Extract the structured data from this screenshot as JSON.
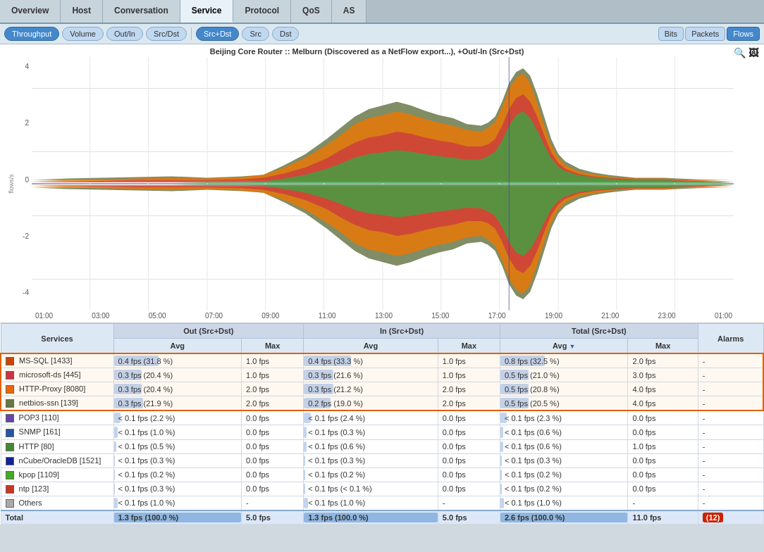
{
  "topNav": {
    "tabs": [
      {
        "label": "Overview",
        "active": false
      },
      {
        "label": "Host",
        "active": false
      },
      {
        "label": "Conversation",
        "active": false
      },
      {
        "label": "Service",
        "active": true
      },
      {
        "label": "Protocol",
        "active": false
      },
      {
        "label": "QoS",
        "active": false
      },
      {
        "label": "AS",
        "active": false
      }
    ]
  },
  "subNav": {
    "leftButtons": [
      {
        "label": "Throughput",
        "active": true
      },
      {
        "label": "Volume",
        "active": false
      },
      {
        "label": "Out/In",
        "active": false
      },
      {
        "label": "Src/Dst",
        "active": false
      },
      {
        "label": "Src+Dst",
        "active": true
      },
      {
        "label": "Src",
        "active": false
      },
      {
        "label": "Dst",
        "active": false
      }
    ],
    "rightButtons": [
      {
        "label": "Bits",
        "active": false
      },
      {
        "label": "Packets",
        "active": false
      },
      {
        "label": "Flows",
        "active": true
      }
    ]
  },
  "chart": {
    "title": "Beijing Core Router :: Melburn (Discovered as a NetFlow export...),  +Out/-In (Src+Dst)",
    "yAxisLabels": [
      "4",
      "2",
      "0",
      "-2",
      "-4"
    ],
    "xAxisLabels": [
      "01:00",
      "03:00",
      "05:00",
      "07:00",
      "09:00",
      "11:00",
      "13:00",
      "15:00",
      "17:00",
      "19:00",
      "21:00",
      "23:00",
      "01:00"
    ],
    "yLabel": "flows/s"
  },
  "table": {
    "groupHeaders": [
      {
        "label": "Out (Src+Dst)",
        "colspan": 2
      },
      {
        "label": "In (Src+Dst)",
        "colspan": 2
      },
      {
        "label": "Total (Src+Dst)",
        "colspan": 2
      }
    ],
    "colHeaders": [
      "Services",
      "Avg",
      "Max",
      "Avg",
      "Max",
      "Avg",
      "Max",
      "Alarms"
    ],
    "rows": [
      {
        "service": "MS-SQL [1433]",
        "color": "#cc4400",
        "highlighted": true,
        "outAvg": "0.4 fps (31.8 %)",
        "outAvgBar": 35,
        "outMax": "1.0 fps",
        "inAvg": "0.4 fps (33.3 %)",
        "inAvgBar": 35,
        "inMax": "1.0 fps",
        "totalAvg": "0.8 fps (32.5 %)",
        "totalAvgBar": 35,
        "totalMax": "2.0 fps",
        "alarms": "-"
      },
      {
        "service": "microsoft-ds [445]",
        "color": "#cc3344",
        "highlighted": true,
        "outAvg": "0.3 fps (20.4 %)",
        "outAvgBar": 22,
        "outMax": "1.0 fps",
        "inAvg": "0.3 fps (21.6 %)",
        "inAvgBar": 22,
        "inMax": "1.0 fps",
        "totalAvg": "0.5 fps (21.0 %)",
        "totalAvgBar": 22,
        "totalMax": "3.0 fps",
        "alarms": "-"
      },
      {
        "service": "HTTP-Proxy [8080]",
        "color": "#ee6600",
        "highlighted": true,
        "outAvg": "0.3 fps (20.4 %)",
        "outAvgBar": 22,
        "outMax": "2.0 fps",
        "inAvg": "0.3 fps (21.2 %)",
        "inAvgBar": 22,
        "inMax": "2.0 fps",
        "totalAvg": "0.5 fps (20.8 %)",
        "totalAvgBar": 22,
        "totalMax": "4.0 fps",
        "alarms": "-"
      },
      {
        "service": "netbios-ssn [139]",
        "color": "#667744",
        "highlighted": true,
        "outAvg": "0.3 fps (21.9 %)",
        "outAvgBar": 23,
        "outMax": "2.0 fps",
        "inAvg": "0.2 fps (19.0 %)",
        "inAvgBar": 20,
        "inMax": "2.0 fps",
        "totalAvg": "0.5 fps (20.5 %)",
        "totalAvgBar": 22,
        "totalMax": "4.0 fps",
        "alarms": "-"
      },
      {
        "service": "POP3 [110]",
        "color": "#6644aa",
        "highlighted": false,
        "outAvg": "< 0.1 fps (2.2 %)",
        "outAvgBar": 5,
        "outMax": "0.0 fps",
        "inAvg": "< 0.1 fps (2.4 %)",
        "inAvgBar": 5,
        "inMax": "0.0 fps",
        "totalAvg": "< 0.1 fps (2.3 %)",
        "totalAvgBar": 5,
        "totalMax": "0.0 fps",
        "alarms": "-"
      },
      {
        "service": "SNMP [161]",
        "color": "#2255aa",
        "highlighted": false,
        "outAvg": "< 0.1 fps (1.0 %)",
        "outAvgBar": 3,
        "outMax": "0.0 fps",
        "inAvg": "< 0.1 fps (0.3 %)",
        "inAvgBar": 2,
        "inMax": "0.0 fps",
        "totalAvg": "< 0.1 fps (0.6 %)",
        "totalAvgBar": 2,
        "totalMax": "0.0 fps",
        "alarms": "-"
      },
      {
        "service": "HTTP [80]",
        "color": "#448833",
        "highlighted": false,
        "outAvg": "< 0.1 fps (0.5 %)",
        "outAvgBar": 2,
        "outMax": "0.0 fps",
        "inAvg": "< 0.1 fps (0.6 %)",
        "inAvgBar": 2,
        "inMax": "0.0 fps",
        "totalAvg": "< 0.1 fps (0.6 %)",
        "totalAvgBar": 2,
        "totalMax": "1.0 fps",
        "alarms": "-"
      },
      {
        "service": "nCube/OracleDB [1521]",
        "color": "#112299",
        "highlighted": false,
        "outAvg": "< 0.1 fps (0.3 %)",
        "outAvgBar": 1,
        "outMax": "0.0 fps",
        "inAvg": "< 0.1 fps (0.3 %)",
        "inAvgBar": 1,
        "inMax": "0.0 fps",
        "totalAvg": "< 0.1 fps (0.3 %)",
        "totalAvgBar": 1,
        "totalMax": "0.0 fps",
        "alarms": "-"
      },
      {
        "service": "kpop [1109]",
        "color": "#44aa22",
        "highlighted": false,
        "outAvg": "< 0.1 fps (0.2 %)",
        "outAvgBar": 1,
        "outMax": "0.0 fps",
        "inAvg": "< 0.1 fps (0.2 %)",
        "inAvgBar": 1,
        "inMax": "0.0 fps",
        "totalAvg": "< 0.1 fps (0.2 %)",
        "totalAvgBar": 1,
        "totalMax": "0.0 fps",
        "alarms": "-"
      },
      {
        "service": "ntp [123]",
        "color": "#cc3322",
        "highlighted": false,
        "outAvg": "< 0.1 fps (0.3 %)",
        "outAvgBar": 1,
        "outMax": "0.0 fps",
        "inAvg": "< 0.1 fps (< 0.1 %)",
        "inAvgBar": 1,
        "inMax": "0.0 fps",
        "totalAvg": "< 0.1 fps (0.2 %)",
        "totalAvgBar": 1,
        "totalMax": "0.0 fps",
        "alarms": "-"
      },
      {
        "service": "Others",
        "color": "#aaaaaa",
        "highlighted": false,
        "outAvg": "< 0.1 fps (1.0 %)",
        "outAvgBar": 3,
        "outMax": "-",
        "inAvg": "< 0.1 fps (1.0 %)",
        "inAvgBar": 3,
        "inMax": "-",
        "totalAvg": "< 0.1 fps (1.0 %)",
        "totalAvgBar": 3,
        "totalMax": "-",
        "alarms": "-"
      }
    ],
    "totalRow": {
      "service": "Total",
      "outAvg": "1.3 fps (100.0 %)",
      "outAvgBar": 100,
      "outMax": "5.0 fps",
      "inAvg": "1.3 fps (100.0 %)",
      "inAvgBar": 100,
      "inMax": "5.0 fps",
      "totalAvg": "2.6 fps (100.0 %)",
      "totalAvgBar": 100,
      "totalMax": "11.0 fps",
      "alarms": "12"
    }
  }
}
